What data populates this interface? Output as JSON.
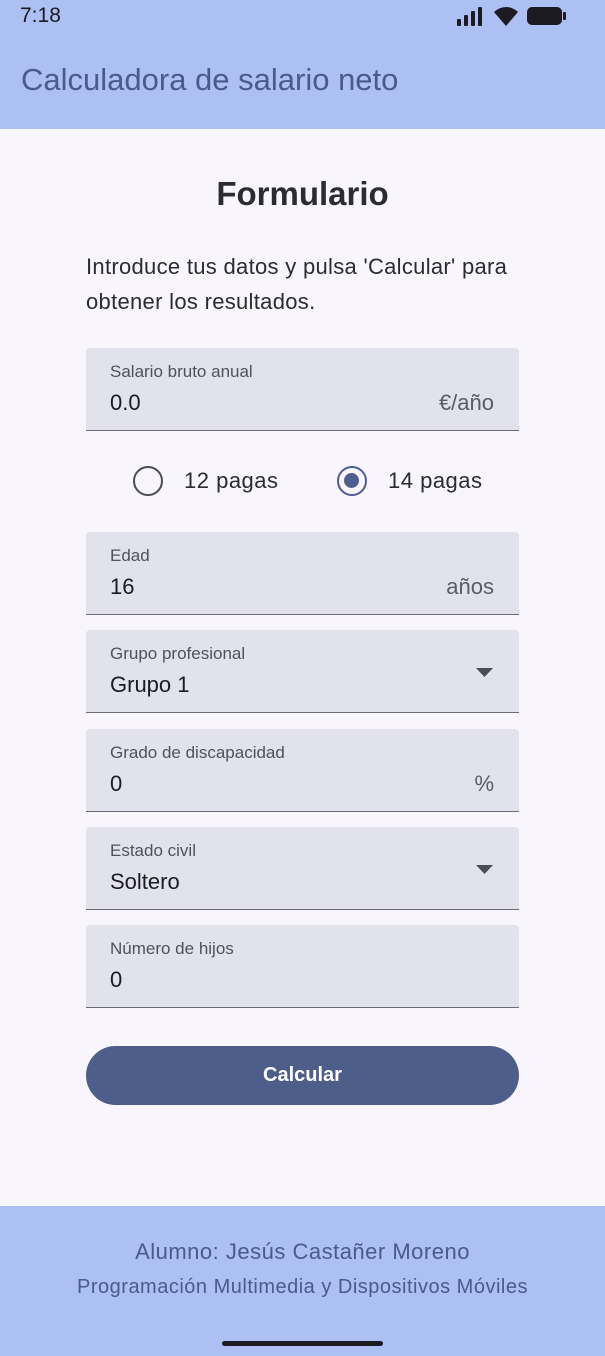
{
  "status_bar": {
    "time": "7:18",
    "icons": [
      "signal-icon",
      "wifi-icon",
      "battery-icon"
    ]
  },
  "app_bar": {
    "title": "Calculadora de salario neto"
  },
  "form": {
    "title": "Formulario",
    "intro": "Introduce tus datos y pulsa 'Calcular' para obtener los resultados.",
    "salary": {
      "label": "Salario bruto anual",
      "value": "0.0",
      "suffix": "€/año"
    },
    "payments": {
      "options": [
        {
          "label": "12 pagas",
          "selected": false
        },
        {
          "label": "14 pagas",
          "selected": true
        }
      ]
    },
    "age": {
      "label": "Edad",
      "value": "16",
      "suffix": "años"
    },
    "professional_group": {
      "label": "Grupo profesional",
      "value": "Grupo 1"
    },
    "disability": {
      "label": "Grado de discapacidad",
      "value": "0",
      "suffix": "%"
    },
    "civil_status": {
      "label": "Estado civil",
      "value": "Soltero"
    },
    "children": {
      "label": "Número de hijos",
      "value": "0"
    },
    "submit_label": "Calcular"
  },
  "footer": {
    "student": "Alumno: Jesús Castañer Moreno",
    "course": "Programación Multimedia y Dispositivos Móviles"
  },
  "colors": {
    "app_bar": "#adc0f3",
    "primary": "#4d5e8a",
    "background": "#f8f6fc",
    "field_background": "#e1e2ec"
  }
}
